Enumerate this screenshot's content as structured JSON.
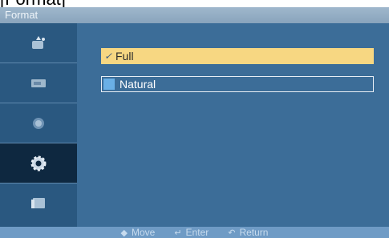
{
  "caption": "[Format]",
  "window": {
    "title": "Format"
  },
  "sidebar": {
    "items": [
      {
        "icon": "picture-icon",
        "active": false
      },
      {
        "icon": "sound-icon",
        "active": false
      },
      {
        "icon": "setup-icon",
        "active": false
      },
      {
        "icon": "gear-icon",
        "active": true
      },
      {
        "icon": "input-icon",
        "active": false
      }
    ]
  },
  "options": [
    {
      "label": "Full",
      "selected": true,
      "marker": "✓"
    },
    {
      "label": "Natural",
      "selected": false
    }
  ],
  "footer": {
    "move_label": "Move",
    "enter_label": "Enter",
    "return_label": "Return",
    "move_icon": "◆",
    "enter_icon": "↵",
    "return_icon": "↶"
  },
  "colors": {
    "osd_bg": "#3c6d98",
    "sidebar_bg": "#2a5880",
    "active_item": "#0e2840",
    "selected_option": "#f7d782",
    "footer_bg": "#6f9bc5"
  }
}
